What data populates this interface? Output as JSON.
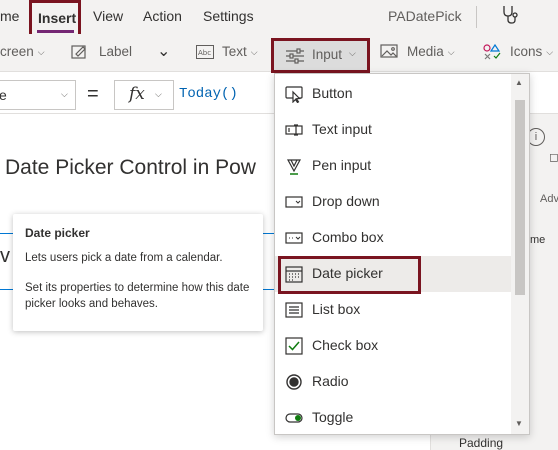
{
  "menu_tabs": {
    "home_partial": "me",
    "insert": "Insert",
    "view": "View",
    "action": "Action",
    "settings": "Settings"
  },
  "app_name": "PADatePick",
  "ribbon": {
    "screen_partial": "creen",
    "label": "Label",
    "text": "Text",
    "input": "Input",
    "media": "Media",
    "icons": "Icons"
  },
  "formula_bar": {
    "property_partial": "e",
    "equals": "=",
    "fx": "fx",
    "formula": "Today()"
  },
  "canvas": {
    "title": "Date Picker Control in Pow",
    "glyph": "v"
  },
  "tooltip": {
    "title": "Date picker",
    "line1": "Lets users pick a date from a calendar.",
    "line2": "Set its properties to determine how this date picker looks and behaves."
  },
  "dropdown": {
    "items": [
      {
        "label": "Button",
        "icon": "button-icon"
      },
      {
        "label": "Text input",
        "icon": "text-input-icon"
      },
      {
        "label": "Pen input",
        "icon": "pen-icon"
      },
      {
        "label": "Drop down",
        "icon": "dropdown-icon"
      },
      {
        "label": "Combo box",
        "icon": "combobox-icon"
      },
      {
        "label": "Date picker",
        "icon": "calendar-icon"
      },
      {
        "label": "List box",
        "icon": "listbox-icon"
      },
      {
        "label": "Check box",
        "icon": "checkbox-icon"
      },
      {
        "label": "Radio",
        "icon": "radio-icon"
      },
      {
        "label": "Toggle",
        "icon": "toggle-icon"
      }
    ]
  },
  "right_panel": {
    "info": "i",
    "adv_partial": "Adv",
    "me_partial": "me",
    "padding": "Padding"
  },
  "colors": {
    "highlight_border": "#7a1420",
    "accent_purple": "#742774",
    "formula_blue": "#0063b1",
    "ribbon_bg": "#f3f2f1"
  }
}
